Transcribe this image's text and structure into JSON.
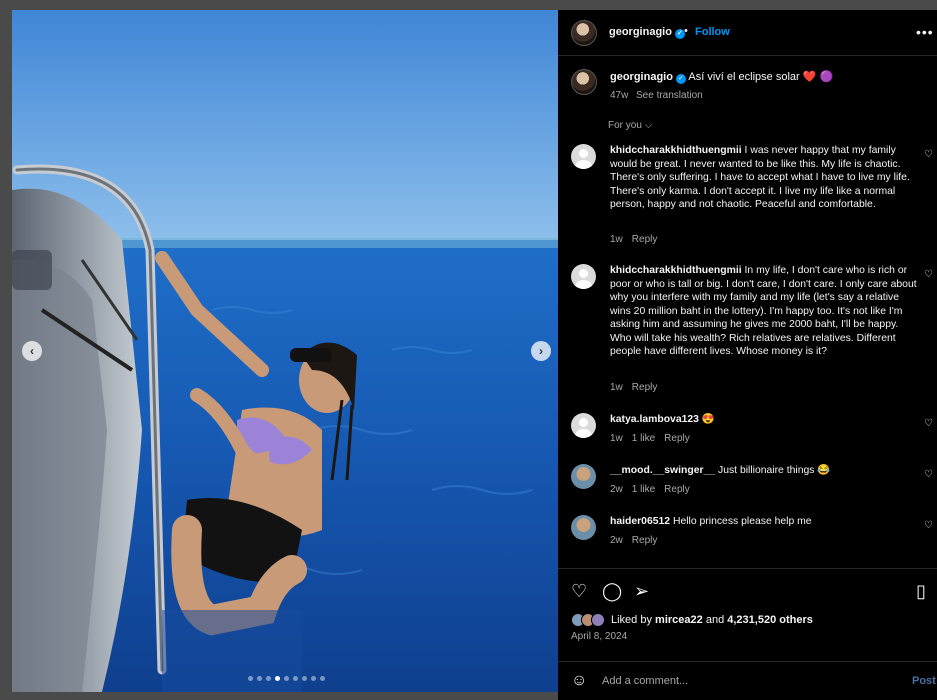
{
  "post": {
    "username": "georginagio",
    "follow_label": "Follow",
    "separator": "•",
    "more_icon": "more-options-icon",
    "caption": "Así viví el eclipse solar ❤️ 🟣",
    "caption_age": "47w",
    "see_translation": "See translation",
    "sort_label": "For you ⌵"
  },
  "photo": {
    "prev_icon": "chevron-left-icon",
    "next_icon": "chevron-right-icon",
    "carousel_count": 9,
    "carousel_active": 3
  },
  "comments": [
    {
      "username": "khidccharakkhidthuengmii",
      "text": "I was never happy that my family would be great. I never wanted to be like this. My life is chaotic. There's only suffering. I have to accept what I have to live my life. There's only karma. I don't accept it. I live my life like a normal person, happy and not chaotic. Peaceful and comfortable.",
      "age": "1w",
      "likes": "",
      "reply": "Reply"
    },
    {
      "username": "khidccharakkhidthuengmii",
      "text": "In my life, I don't care who is rich or poor or who is tall or big. I don't care, I don't care. I only care about why you interfere with my family and my life (let's say a relative wins 20 million baht in the lottery). I'm happy too. It's not like I'm asking him and assuming he gives me 2000 baht, I'll be happy. Who will take his wealth? Rich relatives are relatives. Different people have different lives. Whose money is it?",
      "age": "1w",
      "likes": "",
      "reply": "Reply"
    },
    {
      "username": "katya.lambova123",
      "text": "😍",
      "age": "1w",
      "likes": "1 like",
      "reply": "Reply"
    },
    {
      "username": "__mood.__swinger__",
      "text": "Just billionaire things 😂",
      "age": "2w",
      "likes": "1 like",
      "reply": "Reply"
    },
    {
      "username": "haider06512",
      "text": "Hello princess please help me",
      "age": "2w",
      "likes": "",
      "reply": "Reply"
    }
  ],
  "actions": {
    "like_icon": "heart-icon",
    "comment_icon": "comment-icon",
    "share_icon": "share-icon",
    "save_icon": "bookmark-icon",
    "liked_by_prefix": "Liked by",
    "liked_by_user": "mircea22",
    "liked_by_suffix": "and",
    "others_count": "4,231,520 others",
    "date": "April 8, 2024",
    "add_comment_placeholder": "Add a comment...",
    "post_label": "Post"
  },
  "colors": {
    "accent": "#0095f6",
    "panel_bg": "#000000",
    "muted_text": "#a8a8a8",
    "water": "#1a5fb4",
    "sky": "#4d95e0"
  }
}
